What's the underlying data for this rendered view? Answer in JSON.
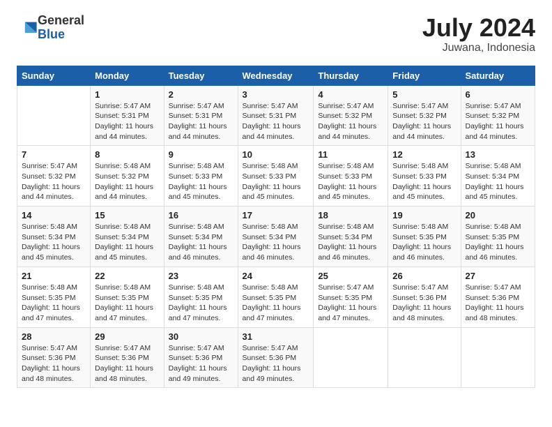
{
  "header": {
    "logo_general": "General",
    "logo_blue": "Blue",
    "month_year": "July 2024",
    "location": "Juwana, Indonesia"
  },
  "days_of_week": [
    "Sunday",
    "Monday",
    "Tuesday",
    "Wednesday",
    "Thursday",
    "Friday",
    "Saturday"
  ],
  "weeks": [
    [
      {
        "day": "",
        "sunrise": "",
        "sunset": "",
        "daylight": ""
      },
      {
        "day": "1",
        "sunrise": "Sunrise: 5:47 AM",
        "sunset": "Sunset: 5:31 PM",
        "daylight": "Daylight: 11 hours and 44 minutes."
      },
      {
        "day": "2",
        "sunrise": "Sunrise: 5:47 AM",
        "sunset": "Sunset: 5:31 PM",
        "daylight": "Daylight: 11 hours and 44 minutes."
      },
      {
        "day": "3",
        "sunrise": "Sunrise: 5:47 AM",
        "sunset": "Sunset: 5:31 PM",
        "daylight": "Daylight: 11 hours and 44 minutes."
      },
      {
        "day": "4",
        "sunrise": "Sunrise: 5:47 AM",
        "sunset": "Sunset: 5:32 PM",
        "daylight": "Daylight: 11 hours and 44 minutes."
      },
      {
        "day": "5",
        "sunrise": "Sunrise: 5:47 AM",
        "sunset": "Sunset: 5:32 PM",
        "daylight": "Daylight: 11 hours and 44 minutes."
      },
      {
        "day": "6",
        "sunrise": "Sunrise: 5:47 AM",
        "sunset": "Sunset: 5:32 PM",
        "daylight": "Daylight: 11 hours and 44 minutes."
      }
    ],
    [
      {
        "day": "7",
        "sunrise": "Sunrise: 5:47 AM",
        "sunset": "Sunset: 5:32 PM",
        "daylight": "Daylight: 11 hours and 44 minutes."
      },
      {
        "day": "8",
        "sunrise": "Sunrise: 5:48 AM",
        "sunset": "Sunset: 5:32 PM",
        "daylight": "Daylight: 11 hours and 44 minutes."
      },
      {
        "day": "9",
        "sunrise": "Sunrise: 5:48 AM",
        "sunset": "Sunset: 5:33 PM",
        "daylight": "Daylight: 11 hours and 45 minutes."
      },
      {
        "day": "10",
        "sunrise": "Sunrise: 5:48 AM",
        "sunset": "Sunset: 5:33 PM",
        "daylight": "Daylight: 11 hours and 45 minutes."
      },
      {
        "day": "11",
        "sunrise": "Sunrise: 5:48 AM",
        "sunset": "Sunset: 5:33 PM",
        "daylight": "Daylight: 11 hours and 45 minutes."
      },
      {
        "day": "12",
        "sunrise": "Sunrise: 5:48 AM",
        "sunset": "Sunset: 5:33 PM",
        "daylight": "Daylight: 11 hours and 45 minutes."
      },
      {
        "day": "13",
        "sunrise": "Sunrise: 5:48 AM",
        "sunset": "Sunset: 5:34 PM",
        "daylight": "Daylight: 11 hours and 45 minutes."
      }
    ],
    [
      {
        "day": "14",
        "sunrise": "Sunrise: 5:48 AM",
        "sunset": "Sunset: 5:34 PM",
        "daylight": "Daylight: 11 hours and 45 minutes."
      },
      {
        "day": "15",
        "sunrise": "Sunrise: 5:48 AM",
        "sunset": "Sunset: 5:34 PM",
        "daylight": "Daylight: 11 hours and 45 minutes."
      },
      {
        "day": "16",
        "sunrise": "Sunrise: 5:48 AM",
        "sunset": "Sunset: 5:34 PM",
        "daylight": "Daylight: 11 hours and 46 minutes."
      },
      {
        "day": "17",
        "sunrise": "Sunrise: 5:48 AM",
        "sunset": "Sunset: 5:34 PM",
        "daylight": "Daylight: 11 hours and 46 minutes."
      },
      {
        "day": "18",
        "sunrise": "Sunrise: 5:48 AM",
        "sunset": "Sunset: 5:34 PM",
        "daylight": "Daylight: 11 hours and 46 minutes."
      },
      {
        "day": "19",
        "sunrise": "Sunrise: 5:48 AM",
        "sunset": "Sunset: 5:35 PM",
        "daylight": "Daylight: 11 hours and 46 minutes."
      },
      {
        "day": "20",
        "sunrise": "Sunrise: 5:48 AM",
        "sunset": "Sunset: 5:35 PM",
        "daylight": "Daylight: 11 hours and 46 minutes."
      }
    ],
    [
      {
        "day": "21",
        "sunrise": "Sunrise: 5:48 AM",
        "sunset": "Sunset: 5:35 PM",
        "daylight": "Daylight: 11 hours and 47 minutes."
      },
      {
        "day": "22",
        "sunrise": "Sunrise: 5:48 AM",
        "sunset": "Sunset: 5:35 PM",
        "daylight": "Daylight: 11 hours and 47 minutes."
      },
      {
        "day": "23",
        "sunrise": "Sunrise: 5:48 AM",
        "sunset": "Sunset: 5:35 PM",
        "daylight": "Daylight: 11 hours and 47 minutes."
      },
      {
        "day": "24",
        "sunrise": "Sunrise: 5:48 AM",
        "sunset": "Sunset: 5:35 PM",
        "daylight": "Daylight: 11 hours and 47 minutes."
      },
      {
        "day": "25",
        "sunrise": "Sunrise: 5:47 AM",
        "sunset": "Sunset: 5:35 PM",
        "daylight": "Daylight: 11 hours and 47 minutes."
      },
      {
        "day": "26",
        "sunrise": "Sunrise: 5:47 AM",
        "sunset": "Sunset: 5:36 PM",
        "daylight": "Daylight: 11 hours and 48 minutes."
      },
      {
        "day": "27",
        "sunrise": "Sunrise: 5:47 AM",
        "sunset": "Sunset: 5:36 PM",
        "daylight": "Daylight: 11 hours and 48 minutes."
      }
    ],
    [
      {
        "day": "28",
        "sunrise": "Sunrise: 5:47 AM",
        "sunset": "Sunset: 5:36 PM",
        "daylight": "Daylight: 11 hours and 48 minutes."
      },
      {
        "day": "29",
        "sunrise": "Sunrise: 5:47 AM",
        "sunset": "Sunset: 5:36 PM",
        "daylight": "Daylight: 11 hours and 48 minutes."
      },
      {
        "day": "30",
        "sunrise": "Sunrise: 5:47 AM",
        "sunset": "Sunset: 5:36 PM",
        "daylight": "Daylight: 11 hours and 49 minutes."
      },
      {
        "day": "31",
        "sunrise": "Sunrise: 5:47 AM",
        "sunset": "Sunset: 5:36 PM",
        "daylight": "Daylight: 11 hours and 49 minutes."
      },
      {
        "day": "",
        "sunrise": "",
        "sunset": "",
        "daylight": ""
      },
      {
        "day": "",
        "sunrise": "",
        "sunset": "",
        "daylight": ""
      },
      {
        "day": "",
        "sunrise": "",
        "sunset": "",
        "daylight": ""
      }
    ]
  ]
}
